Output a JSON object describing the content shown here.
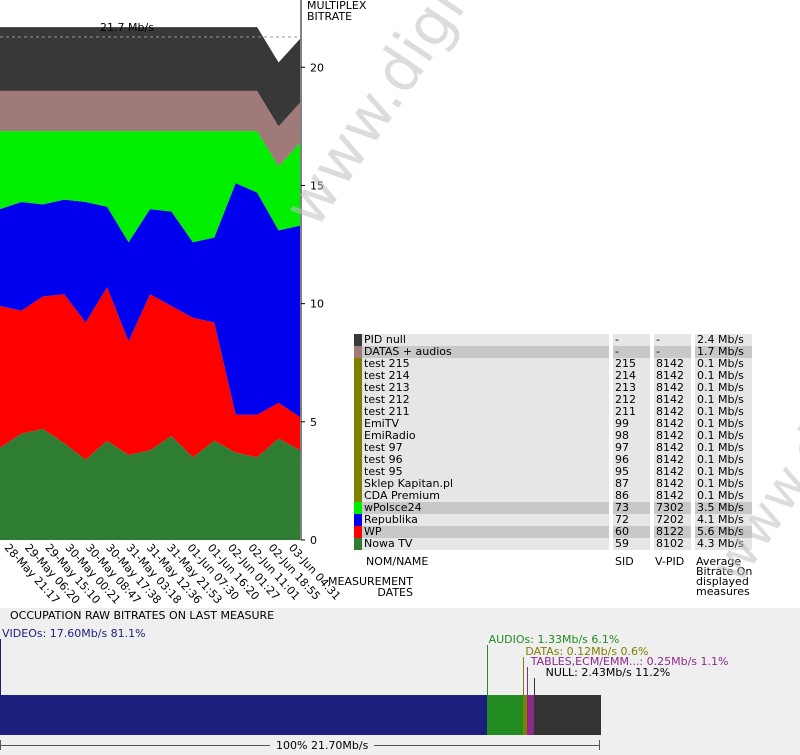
{
  "chart_data": {
    "type": "area",
    "title": "21.7 Mb/s",
    "y_axis_title": "MULTIPLEX BITRATE",
    "x_axis_title": "MEASUREMENT DATES",
    "ylim": [
      0,
      22
    ],
    "yticks": [
      "0",
      "5",
      "10",
      "15",
      "20"
    ],
    "x_tick_labels": [
      "28-May 21:17",
      "29-May 06:20",
      "29-May 15:10",
      "30-May 00:21",
      "30-May 08:47",
      "30-May 17:38",
      "31-May 03:18",
      "31-May 12:36",
      "31-May 21:53",
      "01-Jun 07:30",
      "01-Jun 16:20",
      "02-Jun 01:27",
      "02-Jun 11:01",
      "02-Jun 18:55",
      "03-Jun 04:31"
    ],
    "stack_layers": [
      {
        "name": "Nowa TV",
        "color": "#2e7d32",
        "values": [
          3.9,
          4.5,
          4.7,
          4.1,
          3.4,
          4.2,
          3.6,
          3.8,
          4.4,
          3.5,
          4.2,
          3.7,
          3.5,
          4.3,
          3.8
        ]
      },
      {
        "name": "WP",
        "color": "#ff0000",
        "values": [
          6.0,
          5.2,
          5.6,
          6.3,
          5.8,
          6.5,
          4.8,
          6.6,
          5.5,
          5.9,
          5.0,
          1.6,
          1.8,
          1.5,
          1.4
        ]
      },
      {
        "name": "Republika",
        "color": "#0000ee",
        "values": [
          4.1,
          4.6,
          3.9,
          4.0,
          5.1,
          3.4,
          4.2,
          3.6,
          4.0,
          3.2,
          3.6,
          9.8,
          9.4,
          7.3,
          8.1
        ]
      },
      {
        "name": "wPolsce24",
        "color": "#00ee00",
        "values": [
          3.3,
          3.0,
          3.1,
          2.9,
          3.0,
          3.2,
          4.7,
          3.3,
          3.4,
          4.7,
          4.5,
          2.2,
          2.6,
          2.7,
          3.5
        ]
      },
      {
        "name": "DATAS + audios",
        "color": "#a07a78",
        "values": [
          1.7,
          1.7,
          1.7,
          1.7,
          1.7,
          1.7,
          1.7,
          1.7,
          1.7,
          1.7,
          1.7,
          1.7,
          1.7,
          1.7,
          1.7
        ]
      },
      {
        "name": "PID null",
        "color": "#383838",
        "values": [
          2.7,
          2.7,
          2.7,
          2.7,
          2.7,
          2.7,
          2.7,
          2.7,
          2.7,
          2.7,
          2.7,
          2.7,
          2.7,
          2.7,
          2.7
        ]
      }
    ],
    "legend_headers": {
      "name": "NOM/NAME",
      "sid": "SID",
      "vpid": "V-PID",
      "avg": "Average Bitrate On displayed measures"
    },
    "legend": [
      {
        "name": "PID null",
        "sid": "-",
        "vpid": "-",
        "bitrate": "2.4 Mb/s",
        "color": "#383838",
        "row_bg": "#e6e6e6"
      },
      {
        "name": "DATAS + audios",
        "sid": "-",
        "vpid": "-",
        "bitrate": "1.7 Mb/s",
        "color": "#a07a78",
        "row_bg": "#c8c8c8"
      },
      {
        "name": "test 215",
        "sid": "215",
        "vpid": "8142",
        "bitrate": "0.1 Mb/s",
        "color": "#808000",
        "row_bg": "#e6e6e6"
      },
      {
        "name": "test 214",
        "sid": "214",
        "vpid": "8142",
        "bitrate": "0.1 Mb/s",
        "color": "#808000",
        "row_bg": "#e6e6e6"
      },
      {
        "name": "test 213",
        "sid": "213",
        "vpid": "8142",
        "bitrate": "0.1 Mb/s",
        "color": "#808000",
        "row_bg": "#e6e6e6"
      },
      {
        "name": "test 212",
        "sid": "212",
        "vpid": "8142",
        "bitrate": "0.1 Mb/s",
        "color": "#808000",
        "row_bg": "#e6e6e6"
      },
      {
        "name": "test 211",
        "sid": "211",
        "vpid": "8142",
        "bitrate": "0.1 Mb/s",
        "color": "#808000",
        "row_bg": "#e6e6e6"
      },
      {
        "name": "EmiTV",
        "sid": "99",
        "vpid": "8142",
        "bitrate": "0.1 Mb/s",
        "color": "#808000",
        "row_bg": "#e6e6e6"
      },
      {
        "name": "EmiRadio",
        "sid": "98",
        "vpid": "8142",
        "bitrate": "0.1 Mb/s",
        "color": "#808000",
        "row_bg": "#e6e6e6"
      },
      {
        "name": "test 97",
        "sid": "97",
        "vpid": "8142",
        "bitrate": "0.1 Mb/s",
        "color": "#808000",
        "row_bg": "#e6e6e6"
      },
      {
        "name": "test 96",
        "sid": "96",
        "vpid": "8142",
        "bitrate": "0.1 Mb/s",
        "color": "#808000",
        "row_bg": "#e6e6e6"
      },
      {
        "name": "test 95",
        "sid": "95",
        "vpid": "8142",
        "bitrate": "0.1 Mb/s",
        "color": "#808000",
        "row_bg": "#e6e6e6"
      },
      {
        "name": "Sklep Kapitan.pl",
        "sid": "87",
        "vpid": "8142",
        "bitrate": "0.1 Mb/s",
        "color": "#808000",
        "row_bg": "#e6e6e6"
      },
      {
        "name": "CDA Premium",
        "sid": "86",
        "vpid": "8142",
        "bitrate": "0.1 Mb/s",
        "color": "#808000",
        "row_bg": "#e6e6e6"
      },
      {
        "name": "wPolsce24",
        "sid": "73",
        "vpid": "7302",
        "bitrate": "3.5 Mb/s",
        "color": "#00ee00",
        "row_bg": "#c8c8c8"
      },
      {
        "name": "Republika",
        "sid": "72",
        "vpid": "7202",
        "bitrate": "4.1 Mb/s",
        "color": "#0000ee",
        "row_bg": "#e6e6e6"
      },
      {
        "name": "WP",
        "sid": "60",
        "vpid": "8122",
        "bitrate": "5.6 Mb/s",
        "color": "#ff0000",
        "row_bg": "#c8c8c8"
      },
      {
        "name": "Nowa TV",
        "sid": "59",
        "vpid": "8102",
        "bitrate": "4.3 Mb/s",
        "color": "#2e7d32",
        "row_bg": "#e6e6e6"
      }
    ],
    "occupation": {
      "title": "OCCUPATION RAW BITRATES ON LAST MEASURE",
      "total_label": "100%  21.70Mb/s",
      "total_mbps": 21.7,
      "segments": [
        {
          "key": "videos",
          "label": "VIDEOs: 17.60Mb/s  81.1%",
          "value": 17.6,
          "color": "#1c1f7e",
          "text_color": "#1c1f7e"
        },
        {
          "key": "audios",
          "label": "AUDIOs: 1.33Mb/s  6.1%",
          "value": 1.33,
          "color": "#228b22",
          "text_color": "#228b22"
        },
        {
          "key": "datas",
          "label": "DATAs: 0.12Mb/s  0.6%",
          "value": 0.12,
          "color": "#808000",
          "text_color": "#808000"
        },
        {
          "key": "tables",
          "label": "TABLES,ECM/EMM...: 0.25Mb/s  1.1%",
          "value": 0.25,
          "color": "#8b2a8b",
          "text_color": "#8b2a8b"
        },
        {
          "key": "null",
          "label": "NULL: 2.43Mb/s  11.2%",
          "value": 2.43,
          "color": "#333333",
          "text_color": "#000000"
        }
      ]
    }
  },
  "watermark": {
    "text": "www.digitalbitrate.com"
  }
}
